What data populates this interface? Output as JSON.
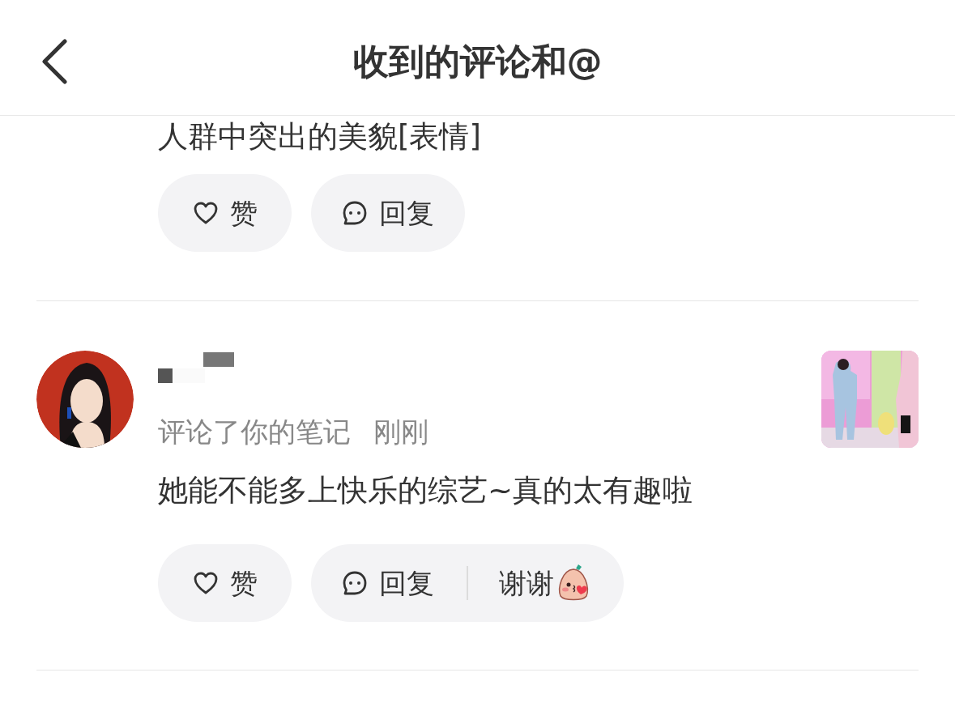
{
  "header": {
    "title": "收到的评论和@"
  },
  "notifications": [
    {
      "comment": "人群中突出的美貌[表情]",
      "actions": [
        {
          "kind": "like",
          "label": "赞"
        },
        {
          "kind": "reply",
          "label": "回复"
        }
      ]
    },
    {
      "name_redacted": true,
      "meta": "评论了你的笔记",
      "time": "刚刚",
      "comment": "她能不能多上快乐的综艺~真的太有趣啦",
      "actions": [
        {
          "kind": "like",
          "label": "赞"
        },
        {
          "kind": "reply",
          "label": "回复",
          "quick_reply": "谢谢"
        }
      ]
    }
  ]
}
